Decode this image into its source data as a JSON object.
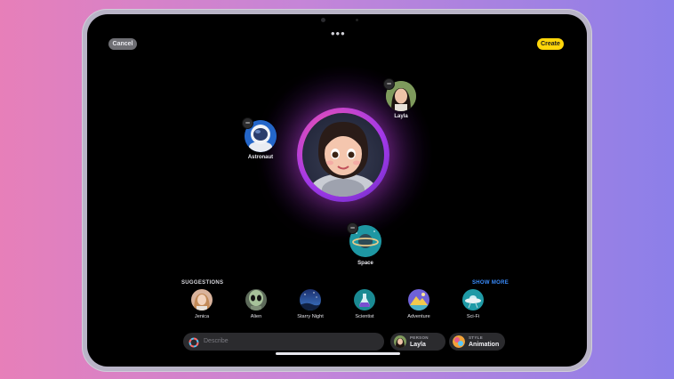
{
  "toolbar": {
    "cancel_label": "Cancel",
    "create_label": "Create",
    "more": "•••"
  },
  "canvas": {
    "bubbles": [
      {
        "id": "layla",
        "label": "Layla",
        "icon": "person-photo-icon"
      },
      {
        "id": "astronaut",
        "label": "Astronaut",
        "icon": "astronaut-helmet-icon"
      },
      {
        "id": "space",
        "label": "Space",
        "icon": "planet-icon"
      }
    ],
    "preview_icon": "astronaut-avatar-icon"
  },
  "suggestions": {
    "title": "SUGGESTIONS",
    "show_more": "SHOW MORE",
    "items": [
      {
        "label": "Jenica",
        "icon": "person-photo-icon"
      },
      {
        "label": "Alien",
        "icon": "alien-icon"
      },
      {
        "label": "Starry Night",
        "icon": "starry-night-icon"
      },
      {
        "label": "Scientist",
        "icon": "flask-icon"
      },
      {
        "label": "Adventure",
        "icon": "mountains-icon"
      },
      {
        "label": "Sci-Fi",
        "icon": "ufo-icon"
      }
    ]
  },
  "bottom_bar": {
    "describe_placeholder": "Describe",
    "person": {
      "caption": "PERSON",
      "value": "Layla"
    },
    "style": {
      "caption": "STYLE",
      "value": "Animation"
    }
  },
  "colors": {
    "accent_create": "#ffd60a",
    "link": "#3a8dff",
    "background": "#000000"
  }
}
